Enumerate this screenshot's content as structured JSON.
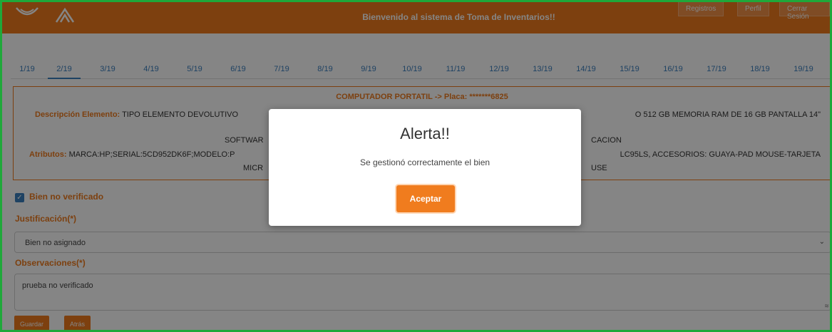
{
  "header": {
    "welcome": "Bienvenido al sistema de Toma de Inventarios!!",
    "buttons": [
      "Registros",
      "Perfil",
      "Cerrar Sesión"
    ]
  },
  "tabs": [
    "1/19",
    "2/19",
    "3/19",
    "4/19",
    "5/19",
    "6/19",
    "7/19",
    "8/19",
    "9/19",
    "10/19",
    "11/19",
    "12/19",
    "13/19",
    "14/19",
    "15/19",
    "16/19",
    "17/19",
    "18/19",
    "19/19"
  ],
  "active_tab": "2/19",
  "item": {
    "title": "COMPUTADOR PORTATIL -> Placa: *******6825",
    "desc_label": "Descripción Elemento:",
    "desc_left": "TIPO ELEMENTO DEVOLUTIVO",
    "desc_right": "O 512 GB MEMORIA RAM DE 16 GB PANTALLA 14\"",
    "software_left": "SOFTWAR",
    "software_right": "CACION",
    "attr_label": "Atributos:",
    "attr_left": "MARCA:HP;SERIAL:5CD952DK6F;MODELO:P",
    "attr_right": "LC95LS, ACCESORIOS: GUAYA-PAD MOUSE-TARJETA",
    "micro_left": "MICR",
    "micro_right": "USE"
  },
  "form": {
    "checkbox_label": "Bien no verificado",
    "justification_label": "Justificación(*)",
    "justification_value": "Bien no asignado",
    "observations_label": "Observaciones(*)",
    "observations_value": "prueba no verificado",
    "save_label": "Guardar",
    "back_label": "Atrás"
  },
  "modal": {
    "title": "Alerta!!",
    "message": "Se gestionó correctamente el bien",
    "accept_label": "Aceptar"
  },
  "colors": {
    "brand": "#f07c1e",
    "frame": "#1fa83a",
    "link": "#3b7fbf"
  }
}
